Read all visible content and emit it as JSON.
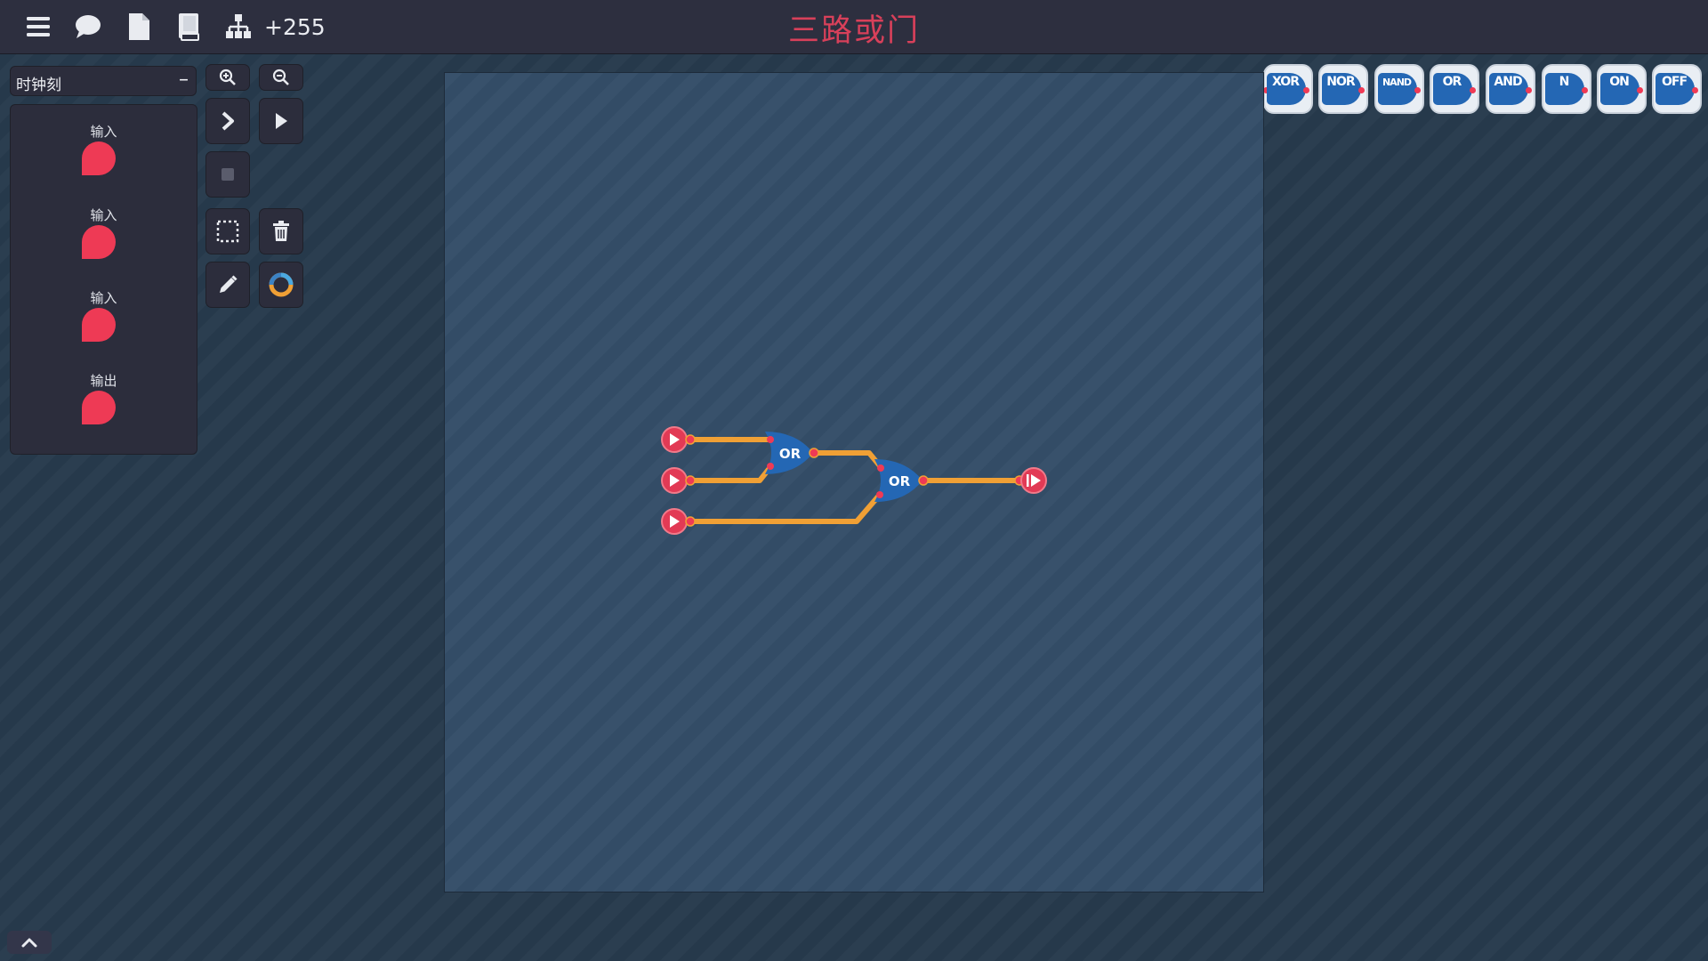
{
  "header": {
    "counter": "+255",
    "level_title": "三路或门",
    "icons": [
      "menu-icon",
      "chat-icon",
      "document-icon",
      "book-icon",
      "hierarchy-icon"
    ]
  },
  "clock": {
    "label": "时钟刻",
    "toggle": "–"
  },
  "io_panel": {
    "items": [
      {
        "label": "输入",
        "kind": "input"
      },
      {
        "label": "输入",
        "kind": "input"
      },
      {
        "label": "输入",
        "kind": "input"
      },
      {
        "label": "输出",
        "kind": "output"
      }
    ]
  },
  "tools": [
    "zoom-in-icon",
    "zoom-out-icon",
    "step-icon",
    "play-icon",
    "stop-icon",
    "select-icon",
    "trash-icon",
    "pencil-icon",
    "color-ring-icon"
  ],
  "palette": {
    "gates": [
      {
        "label": "XOR"
      },
      {
        "label": "NOR"
      },
      {
        "label": "NAND"
      },
      {
        "label": "OR"
      },
      {
        "label": "AND"
      },
      {
        "label": "N"
      },
      {
        "label": "ON"
      },
      {
        "label": "OFF"
      }
    ]
  },
  "circuit": {
    "gates": [
      {
        "label": "OR"
      },
      {
        "label": "OR"
      }
    ],
    "inputs": 3,
    "outputs": 1
  },
  "colors": {
    "title": "#d8405a",
    "pin": "#ee3a55",
    "wire": "#f0a035",
    "gate": "#2467b4"
  }
}
